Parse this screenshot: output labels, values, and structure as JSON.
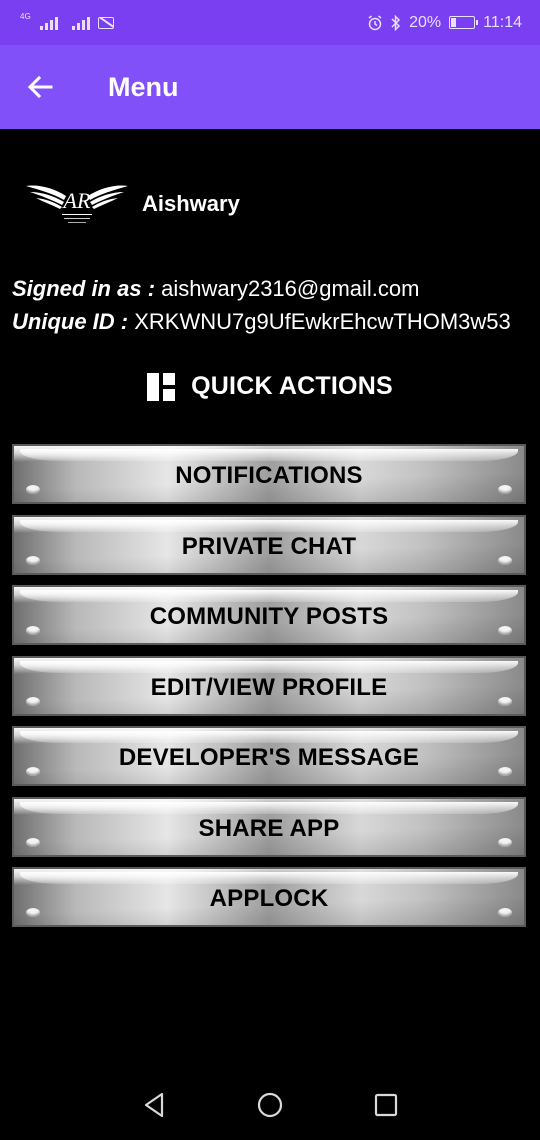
{
  "status_bar": {
    "network_label": "4G",
    "battery_percent": "20%",
    "time": "11:14",
    "battery_level": 0.2
  },
  "app_bar": {
    "title": "Menu",
    "back_icon": "arrow-left-icon"
  },
  "profile": {
    "name": "Aishwary",
    "logo_icon": "winged-ar-logo"
  },
  "account": {
    "signed_in_label": "Signed in as :",
    "email": "aishwary2316@gmail.com",
    "unique_id_label": "Unique ID :",
    "unique_id": "XRKWNU7g9UfEwkrEhcwTHOM3w53"
  },
  "quick_actions": {
    "title": "QUICK ACTIONS",
    "icon": "dashboard-icon",
    "items": [
      {
        "label": "NOTIFICATIONS"
      },
      {
        "label": "PRIVATE CHAT"
      },
      {
        "label": "COMMUNITY POSTS"
      },
      {
        "label": "EDIT/VIEW PROFILE"
      },
      {
        "label": "DEVELOPER'S MESSAGE"
      },
      {
        "label": "SHARE APP"
      },
      {
        "label": "APPLOCK"
      }
    ]
  },
  "nav_bar": {
    "back_icon": "triangle-back-icon",
    "home_icon": "circle-home-icon",
    "recents_icon": "square-recents-icon"
  },
  "colors": {
    "status_bar": "#7b3ff2",
    "app_bar": "#8150f8",
    "background": "#000000"
  }
}
